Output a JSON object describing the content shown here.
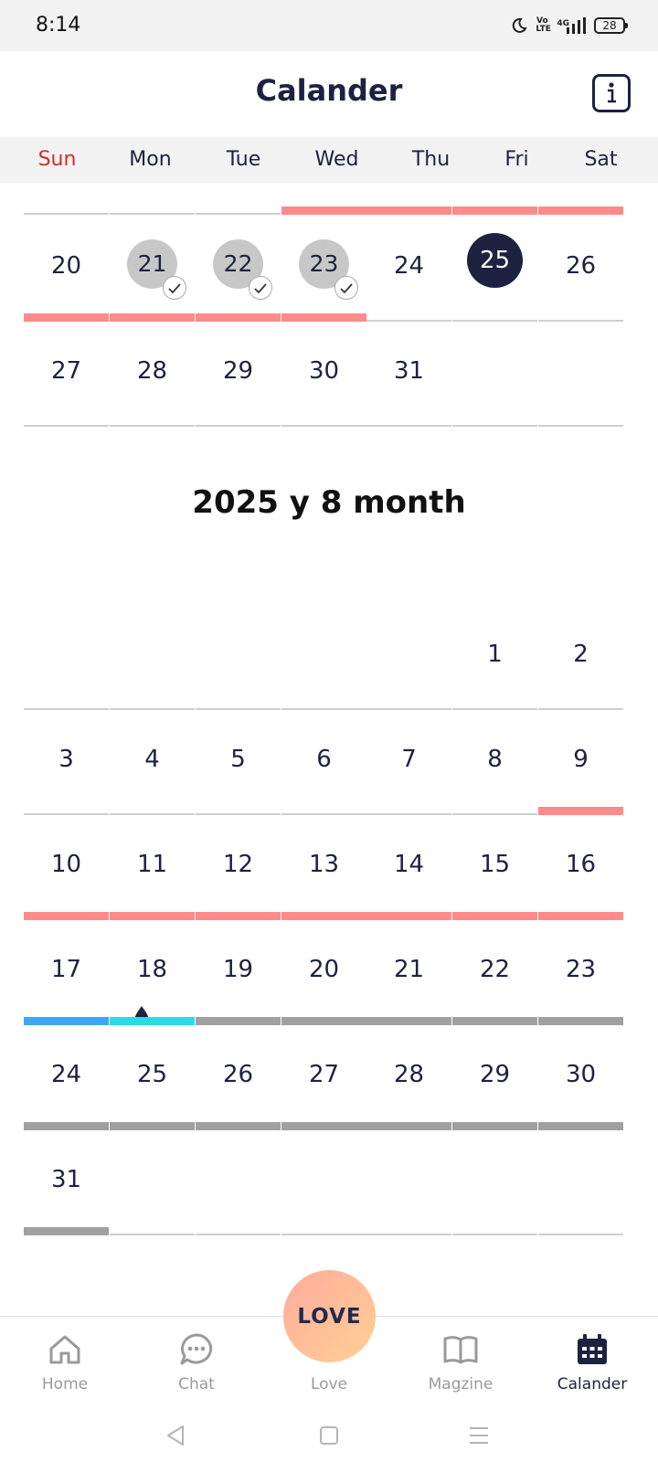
{
  "status_bar": {
    "time": "8:14",
    "volte": "Vo LTE",
    "network": "4G",
    "battery": "28"
  },
  "header": {
    "title": "Calander",
    "info_icon": "info-icon"
  },
  "weekdays": [
    "Sun",
    "Mon",
    "Tue",
    "Wed",
    "Thu",
    "Fri",
    "Sat"
  ],
  "colors": {
    "sunday": "#d52b2b",
    "navy": "#1c2240",
    "period": "#ff8a8a",
    "predicted": "#a0a0a0",
    "fertile": "#27dde3",
    "blue": "#3fa6f2"
  },
  "july": {
    "week_4": [
      "20",
      "21",
      "22",
      "23",
      "24",
      "25",
      "26"
    ],
    "week_5": [
      "27",
      "28",
      "29",
      "30",
      "31"
    ],
    "logged_days": [
      "21",
      "22",
      "23"
    ],
    "today": "25"
  },
  "august": {
    "title": "2025 y 8 month",
    "week_1": [
      "1",
      "2"
    ],
    "week_2": [
      "3",
      "4",
      "5",
      "6",
      "7",
      "8",
      "9"
    ],
    "week_3": [
      "10",
      "11",
      "12",
      "13",
      "14",
      "15",
      "16"
    ],
    "week_4": [
      "17",
      "18",
      "19",
      "20",
      "21",
      "22",
      "23"
    ],
    "week_5": [
      "24",
      "25",
      "26",
      "27",
      "28",
      "29",
      "30"
    ],
    "week_6": [
      "31"
    ]
  },
  "nav": {
    "home": "Home",
    "chat": "Chat",
    "love": "Love",
    "magazine": "Magzine",
    "calendar": "Calander",
    "love_fab": "LOVE"
  }
}
